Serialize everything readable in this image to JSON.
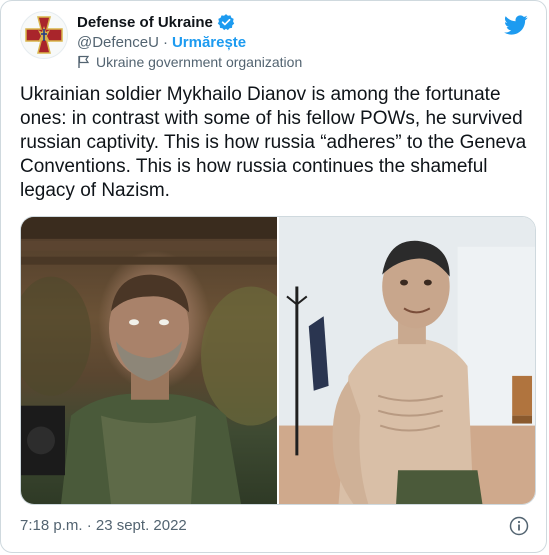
{
  "account": {
    "name": "Defense of Ukraine",
    "handle": "@DefenceU",
    "separator": "·",
    "follow_label": "Urmărește",
    "label": "Ukraine government organization"
  },
  "tweet": {
    "text": "Ukrainian soldier Mykhailo Dianov is among the fortunate ones: in contrast with some of his fellow POWs, he survived russian captivity. This is how russia “adheres” to the Geneva Conventions. This is how russia continues the shameful legacy of Nazism.",
    "timestamp": "7:18 p.m. · 23 sept. 2022"
  },
  "icons": {
    "verified": "verified-badge-icon",
    "twitter": "twitter-bird-icon",
    "flag": "government-flag-icon",
    "info": "info-icon"
  },
  "colors": {
    "accent": "#1d9bf0",
    "text": "#0f1419",
    "muted": "#536471",
    "avatar_red": "#a9252b",
    "avatar_gold": "#d8b54a"
  }
}
